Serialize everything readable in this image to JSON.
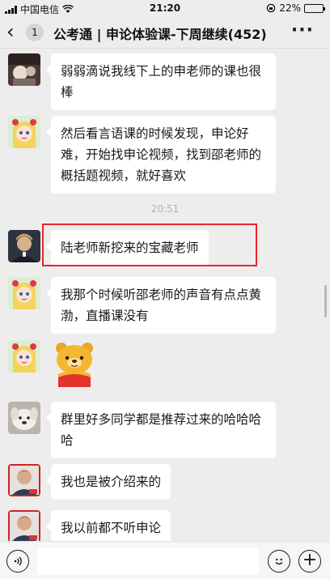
{
  "status_bar": {
    "carrier": "中国电信",
    "time": "21:20",
    "battery": "22%",
    "battery_level": 0.22
  },
  "nav": {
    "back_icon": "chevron-left-icon",
    "unread_count": "1",
    "title": "公考通 | 申论体验课-下周继续(452)",
    "more_icon": "more-icon"
  },
  "messages": [
    {
      "text": "弱弱滴说我线下上的申老师的课也很棒",
      "avatar": "avatar-photo-dark"
    },
    {
      "text": "然后看言语课的时候发现，申论好难，开始找申论视频，找到邵老师的概括题视频，就好喜欢",
      "avatar": "avatar-cartoon-girl"
    },
    {
      "text": "陆老师新挖来的宝藏老师",
      "avatar": "avatar-actor"
    },
    {
      "text": "我那个时候听邵老师的声音有点点黄渤，直播课没有",
      "avatar": "avatar-cartoon-girl"
    },
    {
      "text": "",
      "avatar": "avatar-cartoon-girl",
      "sticker": "winnie-pooh-sticker"
    },
    {
      "text": "群里好多同学都是推荐过来的哈哈哈哈",
      "avatar": "avatar-dog"
    },
    {
      "text": "我也是被介绍来的",
      "avatar": "avatar-man-red"
    },
    {
      "text": "我以前都不听申论",
      "avatar": "avatar-man-red"
    }
  ],
  "timestamp": "20:51",
  "highlight_color": "#e8262b",
  "input_bar": {
    "voice_icon": "voice-icon",
    "emoji_icon": "emoji-icon",
    "plus_icon": "plus-icon",
    "input_value": ""
  }
}
